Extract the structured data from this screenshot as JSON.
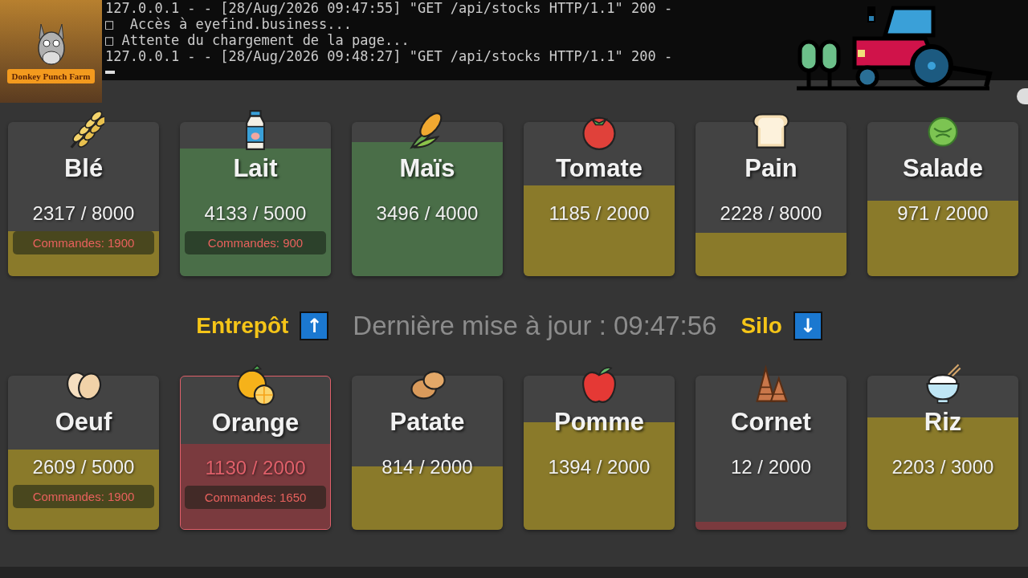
{
  "logo": {
    "text": "Donkey Punch Farm"
  },
  "terminal": {
    "lines": [
      "127.0.0.1 - - [28/Aug/2026 09:47:55] \"GET /api/stocks HTTP/1.1\" 200 -",
      "□  Accès à eyefind.business...",
      "□ Attente du chargement de la page...",
      "127.0.0.1 - - [28/Aug/2026 09:48:27] \"GET /api/stocks HTTP/1.1\" 200 -"
    ]
  },
  "stocks_top": [
    {
      "kind": "wheat",
      "name": "Blé",
      "amount": "2317 / 8000",
      "level": 0.29,
      "color": "#8a7a2a",
      "alert": false,
      "orders": "Commandes: 1900"
    },
    {
      "kind": "milk",
      "name": "Lait",
      "amount": "4133 / 5000",
      "level": 0.83,
      "color": "#4a6e48",
      "alert": false,
      "orders": "Commandes: 900"
    },
    {
      "kind": "corn",
      "name": "Maïs",
      "amount": "3496 / 4000",
      "level": 0.87,
      "color": "#4a6e48",
      "alert": false
    },
    {
      "kind": "tomato",
      "name": "Tomate",
      "amount": "1185 / 2000",
      "level": 0.59,
      "color": "#8a7a2a",
      "alert": false
    },
    {
      "kind": "bread",
      "name": "Pain",
      "amount": "2228 / 8000",
      "level": 0.28,
      "color": "#8a7a2a",
      "alert": false
    },
    {
      "kind": "lettuce",
      "name": "Salade",
      "amount": "971 / 2000",
      "level": 0.49,
      "color": "#8a7a2a",
      "alert": false
    }
  ],
  "status_bar": {
    "warehouse_label": "Entrepôt",
    "warehouse_button": "↑",
    "update_text": "Dernière mise à jour : 09:47:56",
    "silo_label": "Silo",
    "silo_button": "↓"
  },
  "stocks_bottom": [
    {
      "kind": "egg",
      "name": "Oeuf",
      "amount": "2609 / 5000",
      "level": 0.52,
      "color": "#8a7a2a",
      "alert": false,
      "orders": "Commandes: 1900"
    },
    {
      "kind": "orange",
      "name": "Orange",
      "amount": "1130 / 2000",
      "level": 0.56,
      "color": "#7a3a3e",
      "alert": true,
      "orders": "Commandes: 1650"
    },
    {
      "kind": "potato",
      "name": "Patate",
      "amount": "814 / 2000",
      "level": 0.41,
      "color": "#8a7a2a",
      "alert": false
    },
    {
      "kind": "apple",
      "name": "Pomme",
      "amount": "1394 / 2000",
      "level": 0.7,
      "color": "#8a7a2a",
      "alert": false
    },
    {
      "kind": "cone",
      "name": "Cornet",
      "amount": "12 / 2000",
      "level": 0.05,
      "color": "#7a3a3e",
      "alert": false
    },
    {
      "kind": "rice",
      "name": "Riz",
      "amount": "2203 / 3000",
      "level": 0.73,
      "color": "#8a7a2a",
      "alert": false
    }
  ]
}
